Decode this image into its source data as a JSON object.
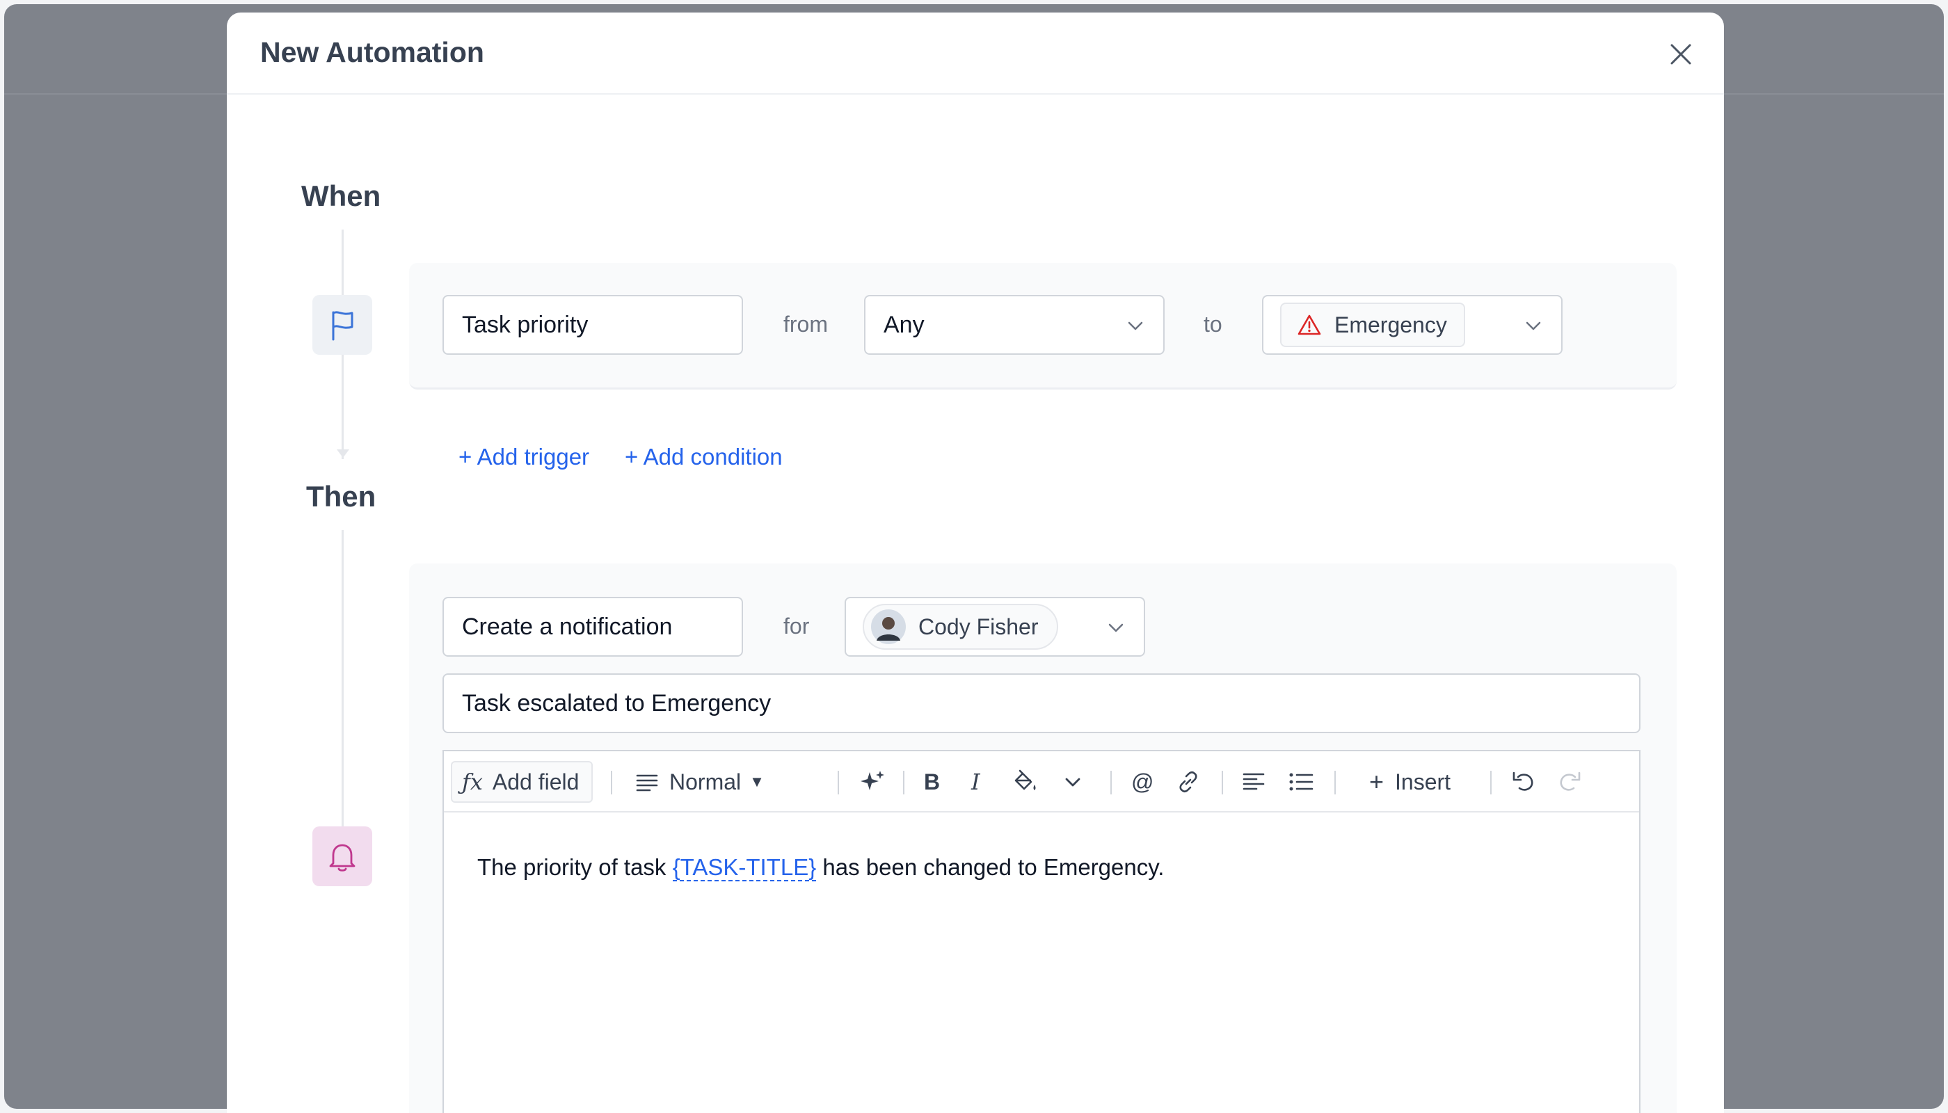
{
  "modal": {
    "title": "New Automation",
    "close_icon": "close-icon"
  },
  "when": {
    "label": "When",
    "icon": "flag-icon",
    "trigger_field": "Task priority",
    "from_word": "from",
    "from_value": "Any",
    "to_word": "to",
    "to_value": "Emergency",
    "to_icon": "warning-triangle-icon",
    "add_trigger": "+ Add trigger",
    "add_condition": "+ Add condition"
  },
  "then": {
    "label": "Then",
    "icon": "bell-icon",
    "action_field": "Create a notification",
    "for_word": "for",
    "recipient": "Cody Fisher",
    "subject": "Task escalated to Emergency"
  },
  "editor": {
    "toolbar": {
      "add_field": "Add field",
      "style": "Normal",
      "insert": "Insert"
    },
    "body_before": "The priority of task ",
    "body_token": "{TASK-TITLE}",
    "body_after": " has been changed to Emergency."
  },
  "colors": {
    "accent": "#2563eb",
    "danger": "#dc2626",
    "notification": "#c0388e",
    "overlay": "#7f838b"
  }
}
